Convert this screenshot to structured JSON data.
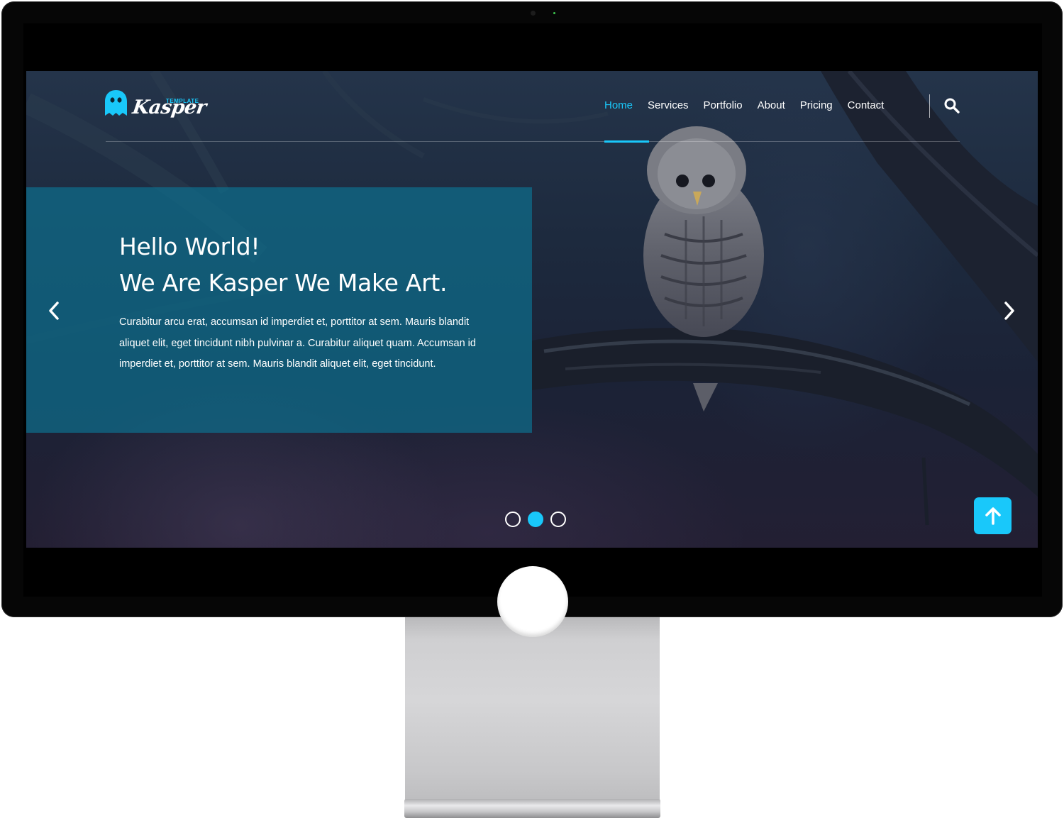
{
  "logo": {
    "name": "Kasper",
    "tag": "TEMPLATE",
    "icon": "ghost-icon"
  },
  "nav": {
    "items": [
      {
        "label": "Home",
        "active": true
      },
      {
        "label": "Services",
        "active": false
      },
      {
        "label": "Portfolio",
        "active": false
      },
      {
        "label": "About",
        "active": false
      },
      {
        "label": "Pricing",
        "active": false
      },
      {
        "label": "Contact",
        "active": false
      }
    ],
    "search_icon": "search-icon"
  },
  "hero": {
    "title_line1": "Hello World!",
    "title_line2": "We Are Kasper We Make Art.",
    "text": "Curabitur arcu erat, accumsan id imperdiet et, porttitor at sem. Mauris blandit aliquet elit, eget tincidunt nibh pulvinar a. Curabitur aliquet quam. Accumsan id imperdiet et, porttitor at sem. Mauris blandit aliquet elit, eget tincidunt."
  },
  "slider": {
    "prev_icon": "chevron-left-icon",
    "next_icon": "chevron-right-icon",
    "dots": 3,
    "active_dot": 2
  },
  "scroll_top": {
    "icon": "arrow-up-icon"
  },
  "colors": {
    "accent": "#19c8fa",
    "hero_box": "#0e6e8c",
    "bezel": "#060606",
    "stand": "#cfcfd1"
  }
}
